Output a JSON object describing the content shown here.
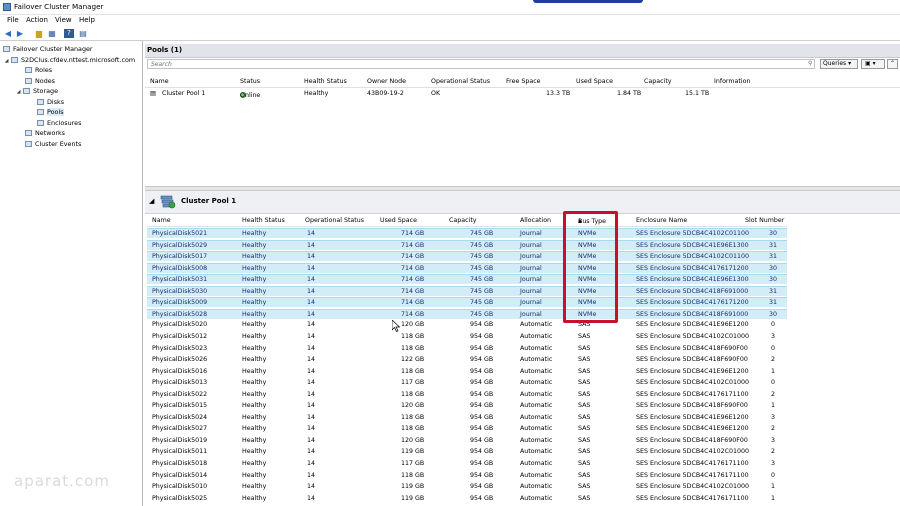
{
  "window": {
    "title": "Failover Cluster Manager"
  },
  "menu": [
    "File",
    "Action",
    "View",
    "Help"
  ],
  "tree": {
    "root": "Failover Cluster Manager",
    "cluster": "S2DClus.cfdev.nttest.microsoft.com",
    "roles": "Roles",
    "nodes": "Nodes",
    "storage": "Storage",
    "disks": "Disks",
    "pools": "Pools",
    "enclosures": "Enclosures",
    "networks": "Networks",
    "events": "Cluster Events"
  },
  "pools_panel": {
    "title": "Pools (1)",
    "search_placeholder": "Search",
    "queries_label": "Queries",
    "columns": [
      "Name",
      "Status",
      "Health Status",
      "Owner Node",
      "Operational Status",
      "Free Space",
      "Used Space",
      "Capacity",
      "Information"
    ],
    "row": {
      "name": "Cluster Pool 1",
      "status": "Online",
      "health": "Healthy",
      "owner": "43B09-19-2",
      "op": "OK",
      "free": "13.3 TB",
      "used": "1.84 TB",
      "capacity": "15.1 TB",
      "info": ""
    }
  },
  "detail": {
    "title": "Cluster Pool 1",
    "columns": [
      "Name",
      "Health Status",
      "Operational Status",
      "Used Space",
      "Capacity",
      "Allocation",
      "Bus Type",
      "Enclosure Name",
      "Slot Number"
    ],
    "sort_column": "Bus Type",
    "disks": [
      [
        "PhysicalDisk5021",
        "Healthy",
        "14",
        "714 GB",
        "745 GB",
        "Journal",
        "NVMe",
        "SES Enclosure 5DCB4C4102C01100",
        "30"
      ],
      [
        "PhysicalDisk5029",
        "Healthy",
        "14",
        "714 GB",
        "745 GB",
        "Journal",
        "NVMe",
        "SES Enclosure 5DCB4C41E96E1300",
        "31"
      ],
      [
        "PhysicalDisk5017",
        "Healthy",
        "14",
        "714 GB",
        "745 GB",
        "Journal",
        "NVMe",
        "SES Enclosure 5DCB4C4102C01100",
        "31"
      ],
      [
        "PhysicalDisk5008",
        "Healthy",
        "14",
        "714 GB",
        "745 GB",
        "Journal",
        "NVMe",
        "SES Enclosure 5DCB4C4176171200",
        "30"
      ],
      [
        "PhysicalDisk5031",
        "Healthy",
        "14",
        "714 GB",
        "745 GB",
        "Journal",
        "NVMe",
        "SES Enclosure 5DCB4C41E96E1300",
        "30"
      ],
      [
        "PhysicalDisk5030",
        "Healthy",
        "14",
        "714 GB",
        "745 GB",
        "Journal",
        "NVMe",
        "SES Enclosure 5DCB4C418F691000",
        "31"
      ],
      [
        "PhysicalDisk5009",
        "Healthy",
        "14",
        "714 GB",
        "745 GB",
        "Journal",
        "NVMe",
        "SES Enclosure 5DCB4C4176171200",
        "31"
      ],
      [
        "PhysicalDisk5028",
        "Healthy",
        "14",
        "714 GB",
        "745 GB",
        "Journal",
        "NVMe",
        "SES Enclosure 5DCB4C418F691000",
        "30"
      ],
      [
        "PhysicalDisk5020",
        "Healthy",
        "14",
        "120 GB",
        "954 GB",
        "Automatic",
        "SAS",
        "SES Enclosure 5DCB4C41E96E1200",
        "0"
      ],
      [
        "PhysicalDisk5012",
        "Healthy",
        "14",
        "118 GB",
        "954 GB",
        "Automatic",
        "SAS",
        "SES Enclosure 5DCB4C4102C01000",
        "3"
      ],
      [
        "PhysicalDisk5023",
        "Healthy",
        "14",
        "118 GB",
        "954 GB",
        "Automatic",
        "SAS",
        "SES Enclosure 5DCB4C418F690F00",
        "0"
      ],
      [
        "PhysicalDisk5026",
        "Healthy",
        "14",
        "122 GB",
        "954 GB",
        "Automatic",
        "SAS",
        "SES Enclosure 5DCB4C418F690F00",
        "2"
      ],
      [
        "PhysicalDisk5016",
        "Healthy",
        "14",
        "118 GB",
        "954 GB",
        "Automatic",
        "SAS",
        "SES Enclosure 5DCB4C41E96E1200",
        "1"
      ],
      [
        "PhysicalDisk5013",
        "Healthy",
        "14",
        "117 GB",
        "954 GB",
        "Automatic",
        "SAS",
        "SES Enclosure 5DCB4C4102C01000",
        "0"
      ],
      [
        "PhysicalDisk5022",
        "Healthy",
        "14",
        "118 GB",
        "954 GB",
        "Automatic",
        "SAS",
        "SES Enclosure 5DCB4C4176171100",
        "2"
      ],
      [
        "PhysicalDisk5015",
        "Healthy",
        "14",
        "120 GB",
        "954 GB",
        "Automatic",
        "SAS",
        "SES Enclosure 5DCB4C418F690F00",
        "1"
      ],
      [
        "PhysicalDisk5024",
        "Healthy",
        "14",
        "118 GB",
        "954 GB",
        "Automatic",
        "SAS",
        "SES Enclosure 5DCB4C41E96E1200",
        "3"
      ],
      [
        "PhysicalDisk5027",
        "Healthy",
        "14",
        "118 GB",
        "954 GB",
        "Automatic",
        "SAS",
        "SES Enclosure 5DCB4C41E96E1200",
        "2"
      ],
      [
        "PhysicalDisk5019",
        "Healthy",
        "14",
        "120 GB",
        "954 GB",
        "Automatic",
        "SAS",
        "SES Enclosure 5DCB4C418F690F00",
        "3"
      ],
      [
        "PhysicalDisk5011",
        "Healthy",
        "14",
        "119 GB",
        "954 GB",
        "Automatic",
        "SAS",
        "SES Enclosure 5DCB4C4102C01000",
        "2"
      ],
      [
        "PhysicalDisk5018",
        "Healthy",
        "14",
        "117 GB",
        "954 GB",
        "Automatic",
        "SAS",
        "SES Enclosure 5DCB4C4176171100",
        "3"
      ],
      [
        "PhysicalDisk5014",
        "Healthy",
        "14",
        "118 GB",
        "954 GB",
        "Automatic",
        "SAS",
        "SES Enclosure 5DCB4C4176171100",
        "0"
      ],
      [
        "PhysicalDisk5010",
        "Healthy",
        "14",
        "119 GB",
        "954 GB",
        "Automatic",
        "SAS",
        "SES Enclosure 5DCB4C4102C01000",
        "1"
      ],
      [
        "PhysicalDisk5025",
        "Healthy",
        "14",
        "119 GB",
        "954 GB",
        "Automatic",
        "SAS",
        "SES Enclosure 5DCB4C4176171100",
        "1"
      ]
    ],
    "highlight_count": 8
  },
  "watermark": "aparat.com",
  "colors": {
    "highlight_row": "#d2ecf8",
    "callout_border": "#c8102e"
  }
}
